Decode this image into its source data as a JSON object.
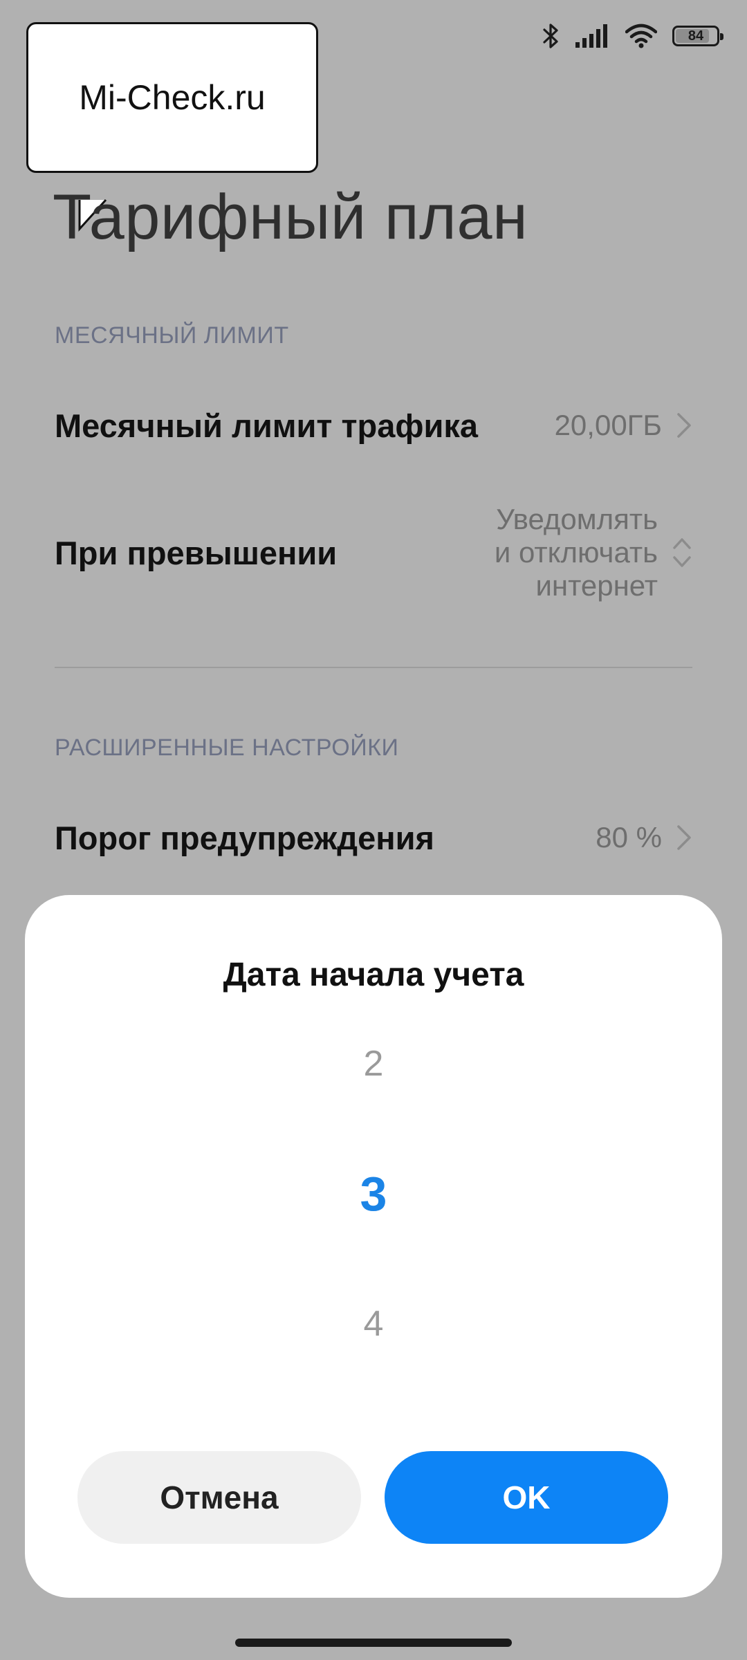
{
  "status_bar": {
    "battery_level": 84,
    "battery_text": "84",
    "icons": [
      "bluetooth-icon",
      "signal-icon",
      "wifi-icon",
      "battery-icon"
    ]
  },
  "watermark": {
    "text": "Mi-Check.ru"
  },
  "page": {
    "title": "Тарифный план",
    "monthly_section": {
      "label": "МЕСЯЧНЫЙ ЛИМИТ",
      "items": [
        {
          "label": "Месячный лимит трафика",
          "value": "20,00ГБ",
          "icon": "chevron-right-icon"
        },
        {
          "label": "При превышении",
          "value_lines": [
            "Уведомлять",
            "и отключать",
            "интернет"
          ],
          "icon": "chevron-updown-icon"
        }
      ]
    },
    "advanced_section": {
      "label": "РАСШИРЕННЫЕ НАСТРОЙКИ",
      "items": [
        {
          "label": "Порог предупреждения",
          "value": "80 %",
          "icon": "chevron-right-icon"
        }
      ]
    }
  },
  "dialog": {
    "title": "Дата начала учета",
    "picker": {
      "prev": "2",
      "selected": "3",
      "next": "4"
    },
    "cancel_label": "Отмена",
    "ok_label": "OK"
  },
  "colors": {
    "accent": "#0d84f6",
    "selected_value": "#1b84e6",
    "overlay_background": "#b1b1b1",
    "section_label": "#6b7186"
  }
}
